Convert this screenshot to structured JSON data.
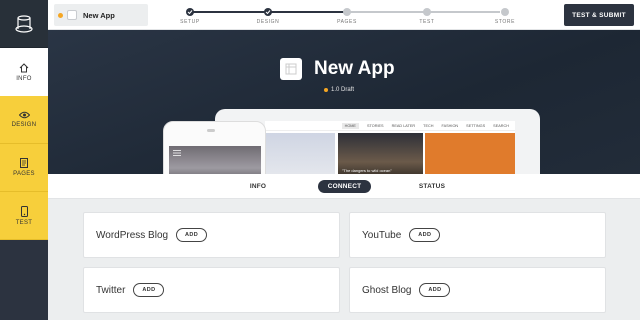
{
  "app": {
    "name": "New App",
    "version": "1.0 Draft"
  },
  "sidebar": {
    "items": [
      {
        "label": "INFO",
        "icon": "home-icon"
      },
      {
        "label": "DESIGN",
        "icon": "eye-icon"
      },
      {
        "label": "PAGES",
        "icon": "document-icon"
      },
      {
        "label": "TEST",
        "icon": "mobile-icon"
      }
    ]
  },
  "steps": [
    {
      "label": "SETUP",
      "done": true
    },
    {
      "label": "DESIGN",
      "done": true
    },
    {
      "label": "PAGES",
      "done": false
    },
    {
      "label": "TEST",
      "done": false
    },
    {
      "label": "STORE",
      "done": false
    }
  ],
  "topbar": {
    "submit_label": "TEST & SUBMIT"
  },
  "preview": {
    "nav": [
      "HOME",
      "STORIES",
      "READ LATER",
      "TECH",
      "FASHION",
      "SETTINGS",
      "SEARCH"
    ],
    "caption": "\"The dangers to wild ocean\""
  },
  "tabs": [
    {
      "label": "INFO"
    },
    {
      "label": "CONNECT"
    },
    {
      "label": "STATUS"
    }
  ],
  "services": [
    {
      "name": "WordPress Blog",
      "action": "ADD"
    },
    {
      "name": "YouTube",
      "action": "ADD"
    },
    {
      "name": "Twitter",
      "action": "ADD"
    },
    {
      "name": "Ghost Blog",
      "action": "ADD"
    }
  ],
  "colors": {
    "dark": "#2c3340",
    "accent": "#f7cf3b",
    "draft_dot": "#f5a623"
  }
}
